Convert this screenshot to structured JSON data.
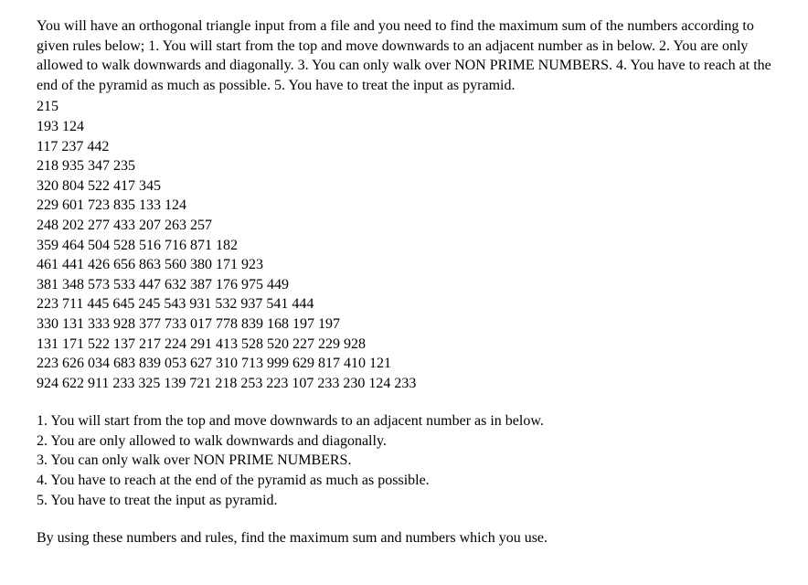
{
  "intro": "You will have an orthogonal triangle input from a file and you need to find the maximum sum of the numbers according to given rules below; 1. You will start from the top and move downwards to an adjacent number as in below. 2. You are only allowed to walk downwards and diagonally. 3. You can only walk over NON PRIME NUMBERS. 4. You have to reach at the end of the pyramid as much as possible. 5. You have to treat the input as pyramid.",
  "pyramid": {
    "rows": [
      "215",
      "193 124",
      "117 237 442",
      "218 935 347 235",
      "320 804 522 417 345",
      "229 601 723 835 133 124",
      "248 202 277 433 207 263 257",
      "359 464 504 528 516 716 871 182",
      "461 441 426 656 863 560 380 171 923",
      "381 348 573 533 447 632 387 176 975 449",
      "223 711 445 645 245 543 931 532 937 541 444",
      "330 131 333 928 377 733 017 778 839 168 197 197",
      "131 171 522 137 217 224 291 413 528 520 227 229 928",
      "223 626 034 683 839 053 627 310 713 999 629 817 410 121",
      "924 622 911 233 325 139 721 218 253 223 107 233 230 124 233"
    ]
  },
  "rules": [
    "1. You will start from the top and move downwards to an adjacent number as in below.",
    "2. You are only allowed to walk downwards and diagonally.",
    "3. You can only walk over NON PRIME NUMBERS.",
    "4. You have to reach at the end of the pyramid as much as possible.",
    "5. You have to treat the input as pyramid."
  ],
  "closing": "By using these numbers and rules, find the maximum sum and numbers which you use."
}
